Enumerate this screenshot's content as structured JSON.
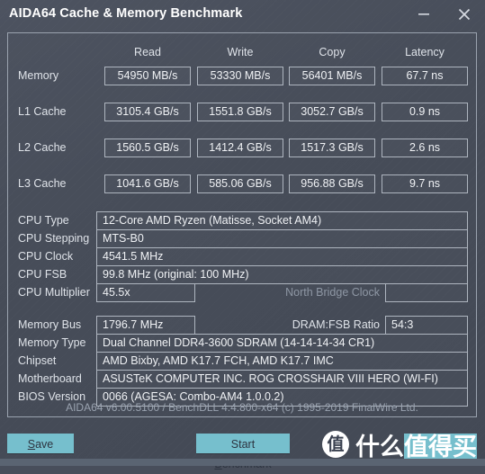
{
  "window": {
    "title": "AIDA64 Cache & Memory Benchmark",
    "minimize_icon": "minimize-icon",
    "close_icon": "close-icon"
  },
  "benchmark": {
    "columns": [
      "Read",
      "Write",
      "Copy",
      "Latency"
    ],
    "rows": [
      {
        "label": "Memory",
        "values": [
          "54950 MB/s",
          "53330 MB/s",
          "56401 MB/s",
          "67.7 ns"
        ]
      },
      {
        "label": "L1 Cache",
        "values": [
          "3105.4 GB/s",
          "1551.8 GB/s",
          "3052.7 GB/s",
          "0.9 ns"
        ]
      },
      {
        "label": "L2 Cache",
        "values": [
          "1560.5 GB/s",
          "1412.4 GB/s",
          "1517.3 GB/s",
          "2.6 ns"
        ]
      },
      {
        "label": "L3 Cache",
        "values": [
          "1041.6 GB/s",
          "585.06 GB/s",
          "956.88 GB/s",
          "9.7 ns"
        ]
      }
    ]
  },
  "cpu_info": {
    "cpu_type_label": "CPU Type",
    "cpu_type_value": "12-Core AMD Ryzen  (Matisse, Socket AM4)",
    "cpu_stepping_label": "CPU Stepping",
    "cpu_stepping_value": "MTS-B0",
    "cpu_clock_label": "CPU Clock",
    "cpu_clock_value": "4541.5 MHz",
    "cpu_fsb_label": "CPU FSB",
    "cpu_fsb_value": "99.8 MHz  (original: 100 MHz)",
    "cpu_multiplier_label": "CPU Multiplier",
    "cpu_multiplier_value": "45.5x",
    "north_bridge_clock_label": "North Bridge Clock",
    "north_bridge_clock_value": ""
  },
  "memory_info": {
    "memory_bus_label": "Memory Bus",
    "memory_bus_value": "1796.7 MHz",
    "dram_fsb_ratio_label": "DRAM:FSB Ratio",
    "dram_fsb_ratio_value": "54:3",
    "memory_type_label": "Memory Type",
    "memory_type_value": "Dual Channel DDR4-3600 SDRAM  (14-14-14-34 CR1)",
    "chipset_label": "Chipset",
    "chipset_value": "AMD Bixby, AMD K17.7 FCH, AMD K17.7 IMC",
    "motherboard_label": "Motherboard",
    "motherboard_value": "ASUSTeK COMPUTER INC. ROG CROSSHAIR VIII HERO (WI-FI)",
    "bios_version_label": "BIOS Version",
    "bios_version_value": "0066  (AGESA: Combo-AM4 1.0.0.2)"
  },
  "footer": {
    "copyright": "AIDA64 v6.00.5100 / BenchDLL 4.4.800-x64  (c) 1995-2019 FinalWire Ltd.",
    "save_prefix": "",
    "save_accel": "S",
    "save_suffix": "ave",
    "start_prefix": "Start ",
    "start_accel": "B",
    "start_suffix": "enchmark"
  },
  "watermark": {
    "logo_char": "值",
    "text_plain": "什么",
    "text_highlight": "值得买"
  },
  "colors": {
    "accent": "#76bfcd",
    "window_bg": "#474d59",
    "cell_border": "#aeb5bf",
    "text": "#e8eaee",
    "dim_text": "#8e97a4"
  }
}
